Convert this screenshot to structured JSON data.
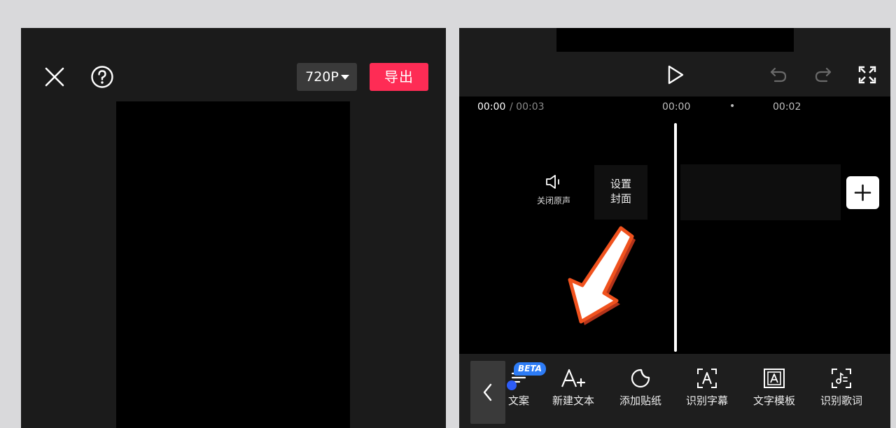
{
  "left_panel": {
    "resolution_label": "720P",
    "export_label": "导出"
  },
  "right_panel": {
    "timecode_current": "00:00",
    "timecode_total": "/ 00:03",
    "ruler_ticks": [
      "00:00",
      "•",
      "00:02"
    ],
    "mute_label": "关闭原声",
    "cover_label_line1": "设置",
    "cover_label_line2": "封面",
    "toolbar": {
      "items": [
        {
          "label": "文案",
          "icon": "text-script-icon"
        },
        {
          "label": "新建文本",
          "icon": "add-text-icon"
        },
        {
          "label": "添加贴纸",
          "icon": "sticker-icon"
        },
        {
          "label": "识别字幕",
          "icon": "caption-recognize-icon"
        },
        {
          "label": "文字模板",
          "icon": "text-template-icon"
        },
        {
          "label": "识别歌词",
          "icon": "lyrics-recognize-icon"
        }
      ],
      "beta_badge": "BETA"
    }
  },
  "colors": {
    "export_red": "#fe2c55",
    "beta_blue": "#2d7cf6",
    "arrow_orange": "#f0521e"
  }
}
